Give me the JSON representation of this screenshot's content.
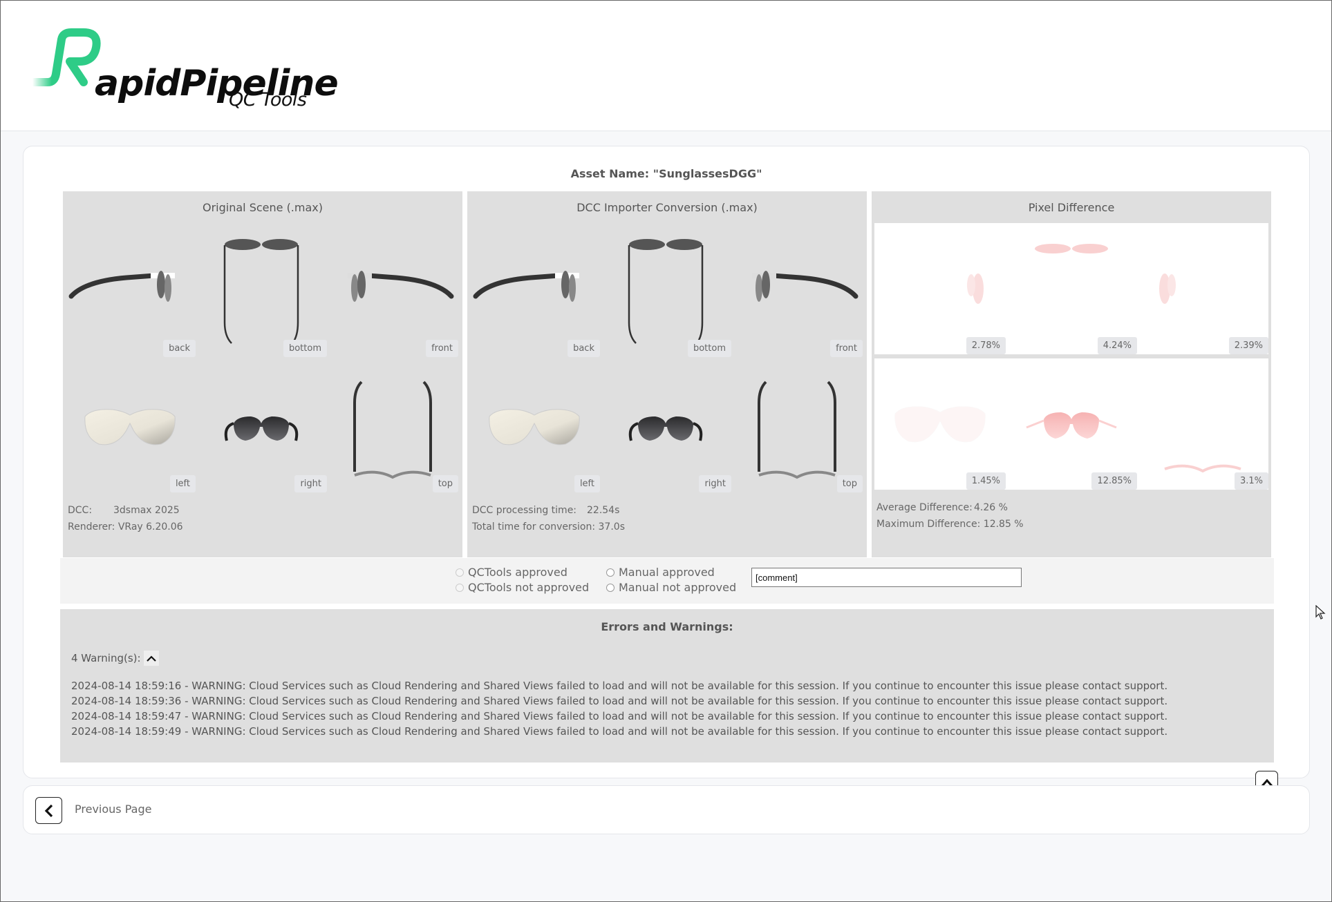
{
  "header": {
    "logo_text": "RapidPipeline",
    "logo_letter": "R",
    "logo_word_rest": "apidPipeline",
    "subtitle": "QC Tools",
    "brand_color": "#2ecc87"
  },
  "asset": {
    "label": "Asset Name: \"SunglassesDGG\""
  },
  "panels": {
    "original": {
      "title": "Original Scene (.max)",
      "views": [
        "back",
        "bottom",
        "front",
        "left",
        "right",
        "top"
      ],
      "info": [
        {
          "label": "DCC:",
          "value": "3dsmax 2025"
        },
        {
          "label": "Renderer:",
          "value": "VRay 6.20.06"
        }
      ]
    },
    "conversion": {
      "title": "DCC Importer Conversion (.max)",
      "views": [
        "back",
        "bottom",
        "front",
        "left",
        "right",
        "top"
      ],
      "info": [
        {
          "label": "DCC processing time:",
          "value": "22.54s"
        },
        {
          "label": "Total time for conversion:",
          "value": "37.0s"
        }
      ]
    },
    "difference": {
      "title": "Pixel Difference",
      "values": [
        "2.78%",
        "4.24%",
        "2.39%",
        "1.45%",
        "12.85%",
        "3.1%"
      ],
      "info": [
        {
          "label": "Average Difference:",
          "value": "4.26 %"
        },
        {
          "label": "Maximum Difference:",
          "value": "12.85 %"
        }
      ]
    }
  },
  "approval": {
    "qctools_approved": "QCTools approved",
    "qctools_not_approved": "QCTools not approved",
    "manual_approved": "Manual approved",
    "manual_not_approved": "Manual not approved",
    "comment_value": "[comment]"
  },
  "errors": {
    "title": "Errors and Warnings:",
    "warning_count": "4 Warning(s):",
    "warnings": [
      "2024-08-14 18:59:16 - WARNING: Cloud Services such as Cloud Rendering and Shared Views failed to load and will not be available for this session. If you continue to encounter this issue please contact support.",
      "2024-08-14 18:59:36 - WARNING: Cloud Services such as Cloud Rendering and Shared Views failed to load and will not be available for this session. If you continue to encounter this issue please contact support.",
      "2024-08-14 18:59:47 - WARNING: Cloud Services such as Cloud Rendering and Shared Views failed to load and will not be available for this session. If you continue to encounter this issue please contact support.",
      "2024-08-14 18:59:49 - WARNING: Cloud Services such as Cloud Rendering and Shared Views failed to load and will not be available for this session. If you continue to encounter this issue please contact support."
    ]
  },
  "nav": {
    "previous_label": "Previous Page"
  }
}
